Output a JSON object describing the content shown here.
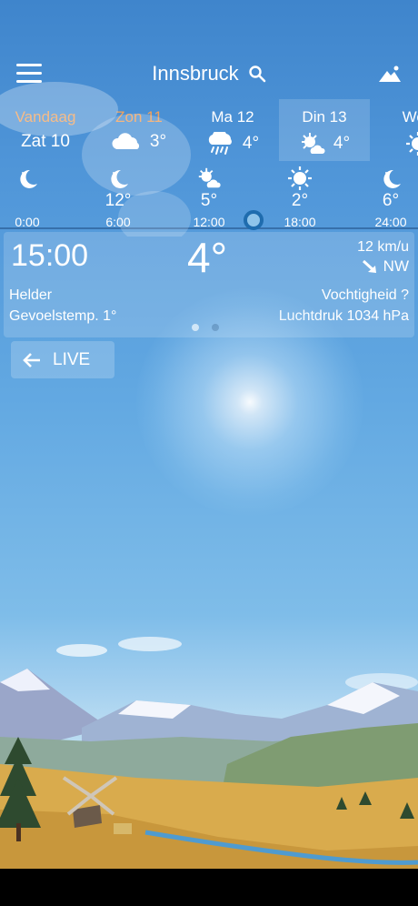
{
  "header": {
    "city": "Innsbruck"
  },
  "days": [
    {
      "name": "Vandaag",
      "value": "Zat 10",
      "icon": "none",
      "highlight": true
    },
    {
      "name": "Zon 11",
      "value": "3°",
      "icon": "cloud-icon",
      "highlight": true
    },
    {
      "name": "Ma 12",
      "value": "4°",
      "icon": "rain-cloud-icon",
      "highlight": false
    },
    {
      "name": "Din 13",
      "value": "4°",
      "icon": "sun-cloud-icon",
      "highlight": false,
      "selected": true
    },
    {
      "name": "Woe",
      "value": "",
      "icon": "sun-icon",
      "highlight": false
    }
  ],
  "hours": [
    {
      "time": "0:00",
      "temp": "",
      "icon": "moon-icon"
    },
    {
      "time": "6:00",
      "temp": "12°",
      "icon": "moon-icon"
    },
    {
      "time": "12:00",
      "temp": "5°",
      "icon": "sun-cloud-icon"
    },
    {
      "time": "18:00",
      "temp": "2°",
      "icon": "sun-icon"
    },
    {
      "time": "24:00",
      "temp": "6°",
      "icon": "moon-icon"
    }
  ],
  "detail": {
    "time": "15:00",
    "temp": "4°",
    "wind_speed": "12 km/u",
    "wind_dir": "NW",
    "condition": "Helder",
    "feels_like": "Gevoelstemp. 1°",
    "humidity": "Vochtigheid ?",
    "pressure": "Luchtdruk 1034 hPa"
  },
  "live_label": "LIVE",
  "colors": {
    "accent_orange": "#f3a25b",
    "scrub": "#1f6cae"
  }
}
